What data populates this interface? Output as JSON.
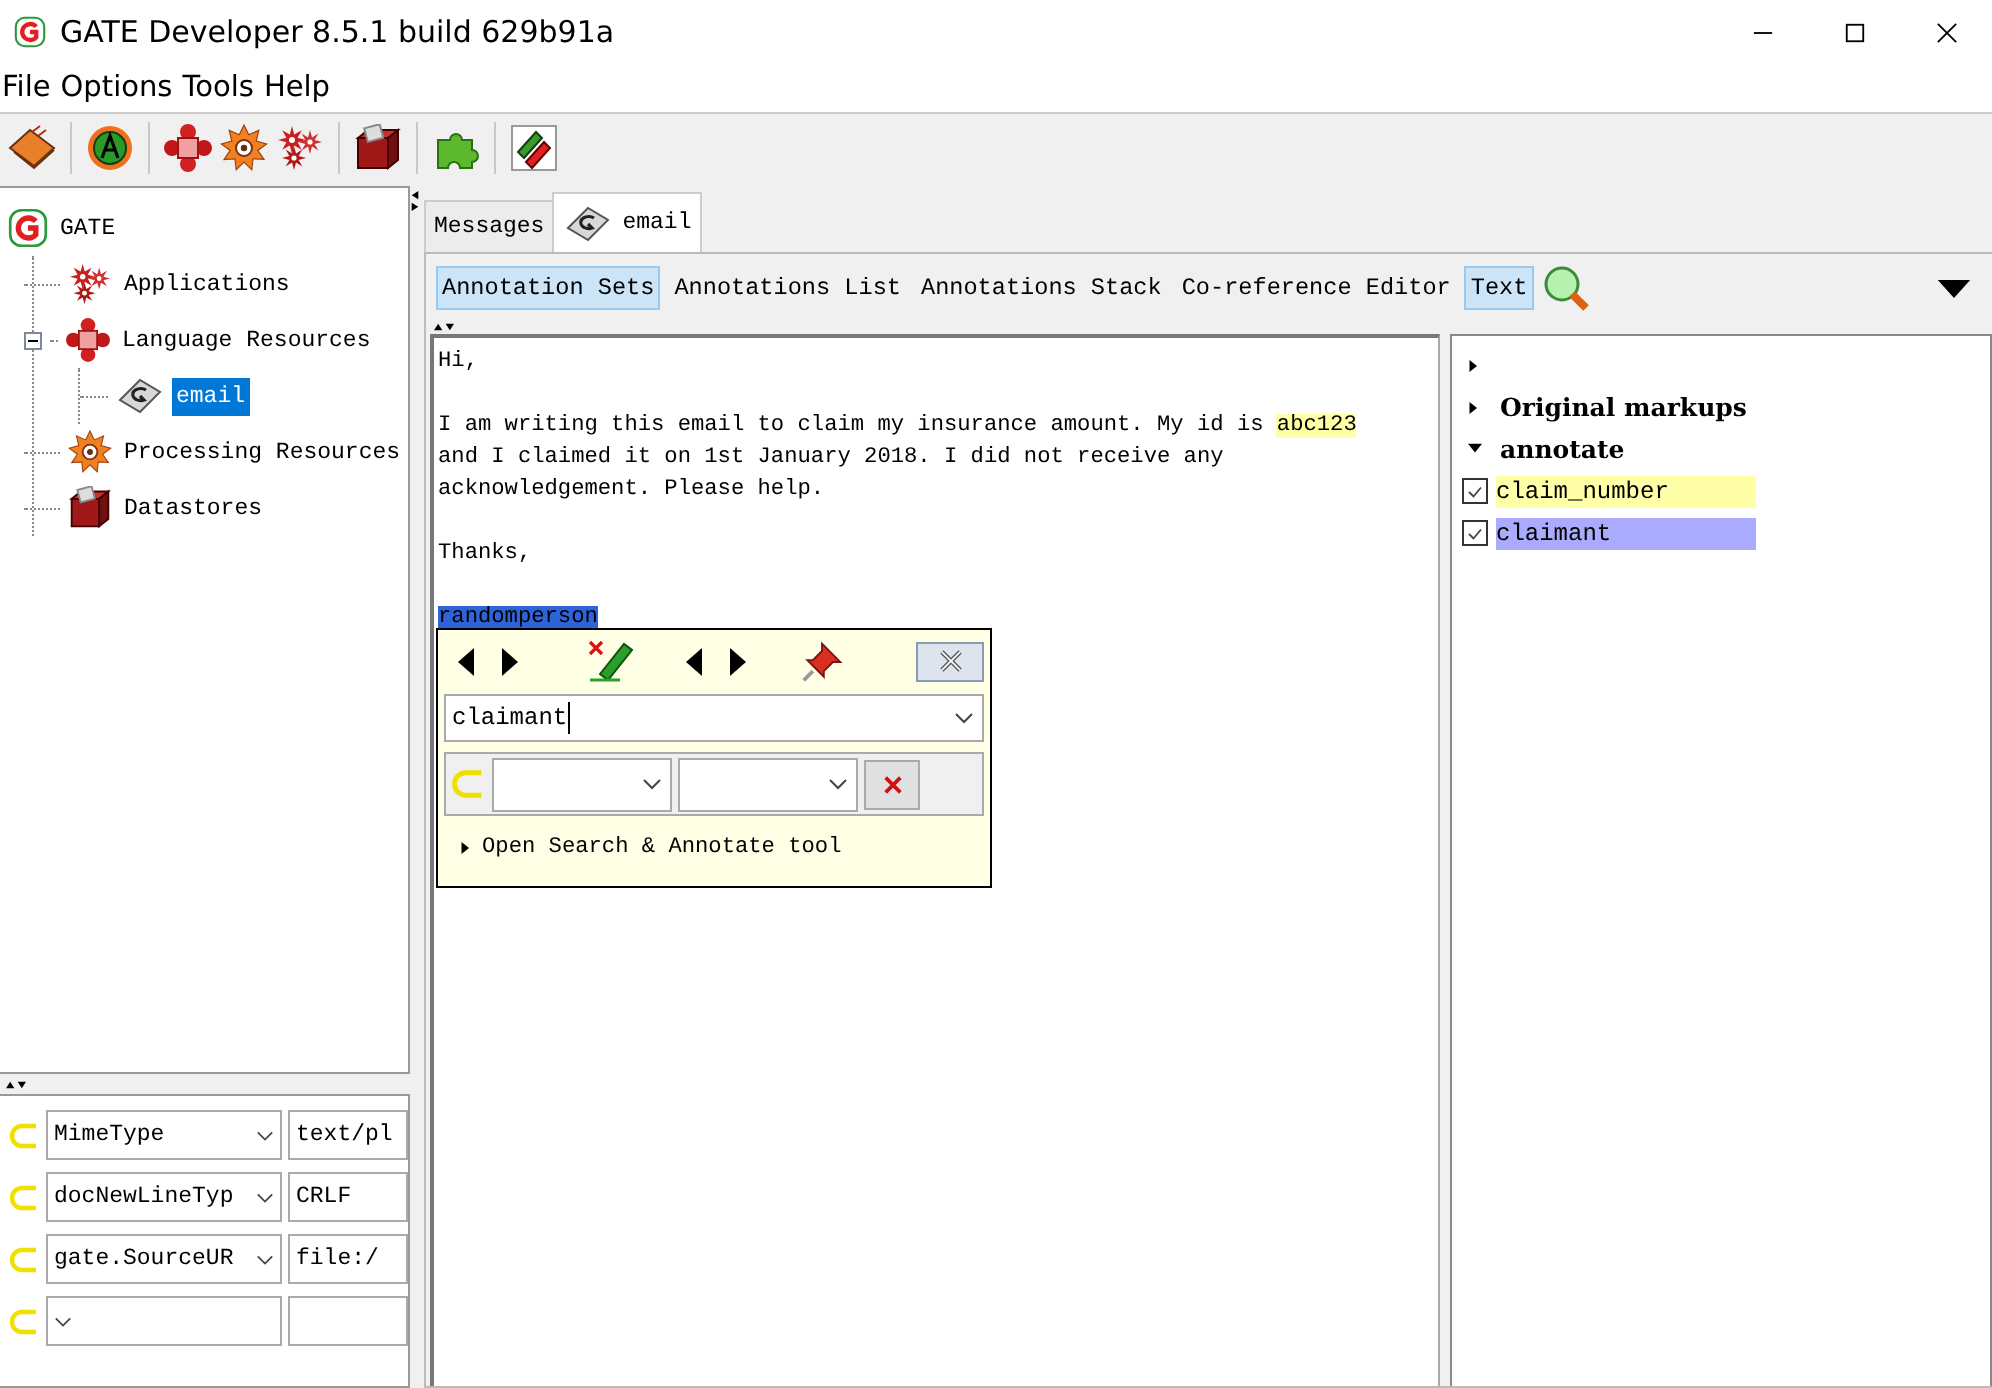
{
  "window": {
    "title": "GATE Developer 8.5.1 build 629b91a"
  },
  "menu": [
    "File",
    "Options",
    "Tools",
    "Help"
  ],
  "tree": {
    "label": "GATE",
    "selected": false,
    "children": [
      {
        "label": "Applications",
        "selected": false
      },
      {
        "label": "Language Resources",
        "selected": false,
        "expanded": true,
        "children": [
          {
            "label": "email",
            "selected": true
          }
        ]
      },
      {
        "label": "Processing Resources",
        "selected": false
      },
      {
        "label": "Datastores",
        "selected": false
      }
    ]
  },
  "features": [
    {
      "key": "MimeType",
      "value": "text/pl"
    },
    {
      "key": "docNewLineTyp",
      "value": "CRLF"
    },
    {
      "key": "gate.SourceUR",
      "value": "file:/"
    }
  ],
  "tabs": [
    {
      "label": "Messages",
      "selected": false
    },
    {
      "label": "email",
      "selected": true
    }
  ],
  "view_buttons": [
    {
      "label": "Annotation Sets",
      "selected": true
    },
    {
      "label": "Annotations List",
      "selected": false
    },
    {
      "label": "Annotations Stack",
      "selected": false
    },
    {
      "label": "Co-reference Editor",
      "selected": false
    },
    {
      "label": "Text",
      "selected": true
    }
  ],
  "document": {
    "paragraphs": [
      [
        [
          {
            "text": "Hi,"
          }
        ]
      ],
      [
        [
          {
            "text": "I am writing this email to claim my insurance amount. My id is "
          },
          {
            "text": "abc123",
            "color": "#ffffa8"
          }
        ],
        [
          {
            "text": "and I claimed it on 1st January 2018. I did not receive any"
          }
        ],
        [
          {
            "text": "acknowledgement. Please help."
          }
        ]
      ],
      [
        [
          {
            "text": "Thanks,"
          }
        ]
      ],
      [
        [
          {
            "text": "randomperson",
            "color": "#2f64d8"
          }
        ]
      ]
    ]
  },
  "annotation_editor": {
    "type": "claimant",
    "search_tool": {
      "label": "Open Search & Annotate tool",
      "expanded": false
    }
  },
  "annotation_sets": [
    {
      "expanded": false
    },
    {
      "name": "Original markups",
      "expanded": false
    },
    {
      "name": "annotate",
      "expanded": true,
      "types": [
        {
          "name": "claim_number",
          "checked": true,
          "color": "#ffffa8"
        },
        {
          "name": "claimant",
          "checked": true,
          "color": "#aaaaff"
        }
      ]
    }
  ]
}
